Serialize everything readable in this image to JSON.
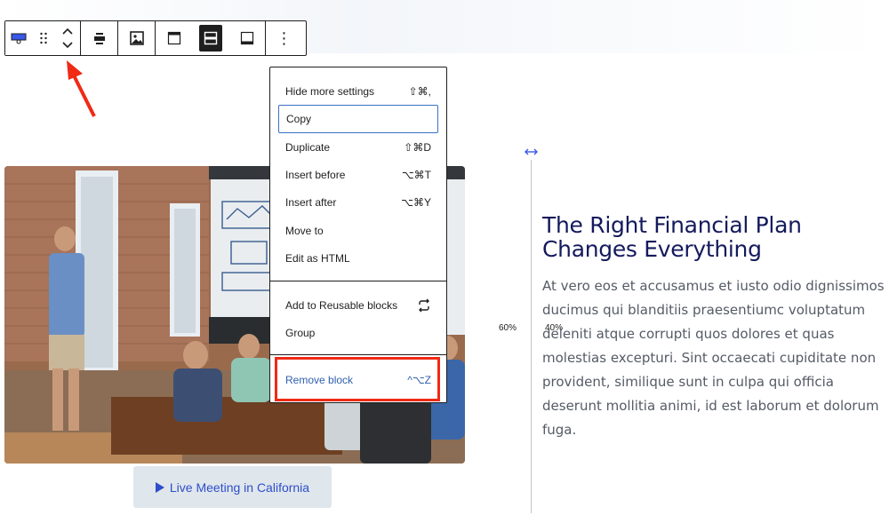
{
  "toolbar": {
    "items": [
      {
        "name": "block-type-icon"
      },
      {
        "name": "drag-handle-icon"
      },
      {
        "name": "move-up-down-icon"
      },
      {
        "name": "align-icon"
      },
      {
        "name": "replace-image-icon"
      },
      {
        "name": "align-top-icon"
      },
      {
        "name": "align-middle-icon",
        "active": true
      },
      {
        "name": "align-bottom-icon"
      },
      {
        "name": "more-options-icon",
        "label": "⋮"
      }
    ]
  },
  "menu": {
    "sections": [
      [
        {
          "label": "Hide more settings",
          "shortcut": "⇧⌘,"
        },
        {
          "label": "Copy",
          "shortcut": "",
          "focused": true
        },
        {
          "label": "Duplicate",
          "shortcut": "⇧⌘D"
        },
        {
          "label": "Insert before",
          "shortcut": "⌥⌘T"
        },
        {
          "label": "Insert after",
          "shortcut": "⌥⌘Y"
        },
        {
          "label": "Move to",
          "shortcut": ""
        },
        {
          "label": "Edit as HTML",
          "shortcut": ""
        }
      ],
      [
        {
          "label": "Add to Reusable blocks",
          "icon": "reusable-icon"
        },
        {
          "label": "Group",
          "shortcut": ""
        }
      ],
      [
        {
          "label": "Remove block",
          "shortcut": "^⌥Z"
        }
      ]
    ]
  },
  "media": {
    "button_label": "Live Meeting in California"
  },
  "split": {
    "left_pct": "60%",
    "right_pct": "40%"
  },
  "content": {
    "heading": "The Right Financial Plan Changes Everything",
    "body": "At vero eos et accusamus et iusto odio dignissimos ducimus qui blanditiis praesentiumc voluptatum deleniti atque corrupti quos dolores et quas molestias excepturi. Sint occaecati cupiditate non provident, similique sunt in culpa qui officia deserunt mollitia animi, id est laborum et dolorum fuga."
  },
  "colors": {
    "accent": "#2f4ec9",
    "highlight": "#f02a15",
    "heading": "#141a5c"
  }
}
